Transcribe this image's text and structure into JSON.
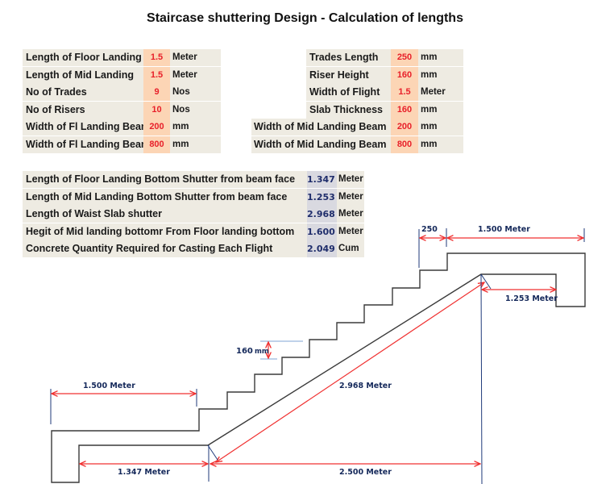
{
  "title": "Staircase shuttering Design - Calculation of lengths",
  "inputs_left": [
    {
      "label": "Length of Floor Landing",
      "value": "1.5",
      "unit": "Meter"
    },
    {
      "label": "Length of Mid Landing",
      "value": "1.5",
      "unit": "Meter"
    },
    {
      "label": "No of Trades",
      "value": "9",
      "unit": "Nos"
    },
    {
      "label": "No of Risers",
      "value": "10",
      "unit": "Nos"
    },
    {
      "label": "Width of Fl Landing Beam",
      "value": "200",
      "unit": "mm"
    },
    {
      "label": "Width of Fl Landing Beam",
      "value": "800",
      "unit": "mm"
    }
  ],
  "inputs_right": [
    {
      "label": "Trades Length",
      "value": "250",
      "unit": "mm"
    },
    {
      "label": "Riser Height",
      "value": "160",
      "unit": "mm"
    },
    {
      "label": "Width of Flight",
      "value": "1.5",
      "unit": "Meter"
    },
    {
      "label": "Slab Thickness",
      "value": "160",
      "unit": "mm"
    },
    {
      "label": "Width of Mid Landing Beam",
      "value": "200",
      "unit": "mm"
    },
    {
      "label": "Width of Mid Landing Beam",
      "value": "800",
      "unit": "mm"
    }
  ],
  "results": [
    {
      "label": "Length of Floor Landing Bottom Shutter from beam face",
      "value": "1.347",
      "unit": "Meter"
    },
    {
      "label": "Length of Mid Landing Bottom Shutter from beam face",
      "value": "1.253",
      "unit": "Meter"
    },
    {
      "label": "Length of Waist Slab shutter",
      "value": "2.968",
      "unit": "Meter"
    },
    {
      "label": "Hegit of Mid landing bottomr From Floor landing bottom",
      "value": "1.600",
      "unit": "Meter"
    },
    {
      "label": "Concrete Quantity Required for Casting Each Flight",
      "value": "2.049",
      "unit": "Cum"
    }
  ],
  "diagram": {
    "dim_trade": "250",
    "dim_mid_landing": "1.500  Meter",
    "dim_mid_bottom": "1.253  Meter",
    "dim_riser_value": "160",
    "dim_riser_unit": "mm",
    "dim_floor_landing": "1.500  Meter",
    "dim_waist": "2.968  Meter",
    "dim_floor_bottom": "1.347  Meter",
    "dim_horizontal": "2.500  Meter",
    "colors": {
      "outline": "#3a3a3a",
      "dimension": "#f03030",
      "extension": "#1f3a7a",
      "riser_guide": "#7fa6d6",
      "text": "#14285a"
    }
  }
}
